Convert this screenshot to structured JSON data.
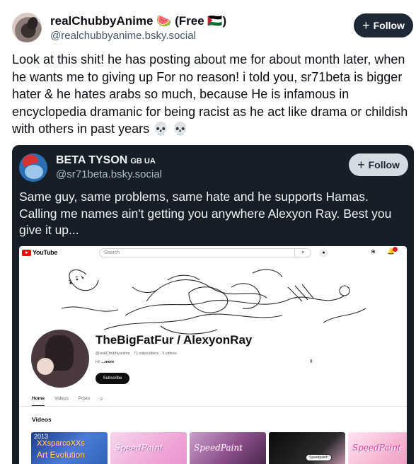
{
  "post": {
    "author_name": "realChubbyAnime 🍉 (Free 🇵🇸)",
    "author_handle": "@realchubbyanime.bsky.social",
    "follow_label": "Follow",
    "text": "Look at this shit! he has posting about me for about month later, when he wants me to giving up For no reason! i told you, sr71beta is bigger hater & he hates arabs so much, because He is infamous in encyclopedia dramanic for being racist as he act like drama or childish with others in past years 💀 💀"
  },
  "embed": {
    "author_name": "BETA TYSON",
    "author_flags": "GB UA",
    "author_handle": "@sr71beta.bsky.social",
    "follow_label": "Follow",
    "text": "Same guy, same problems, same hate and he supports Hamas. Calling me names ain't getting you anywhere Alexyon Ray. Best you give it up...",
    "background": "#161e27"
  },
  "youtube": {
    "logo_text": "YouTube",
    "search_placeholder": "Search",
    "notification_badge": "9+",
    "channel_name": "TheBigFatFur / AlexyonRay",
    "channel_meta": "@realChubbyanime · 71 subscribers · 5 videos",
    "channel_desc_prefix": "Hi!",
    "channel_desc_more": "...more",
    "subscribe_label": "Subscribe",
    "tabs": [
      "Home",
      "Videos",
      "Posts"
    ],
    "active_tab": "Home",
    "section_title": "Videos",
    "thumbnails": [
      {
        "line1": "2013",
        "line2": "XXsparcoXXs",
        "line3": "Art Evolution"
      },
      {
        "script": "SpeedPaint"
      },
      {
        "script": "SpeedPaint"
      },
      {
        "pill": "Speedpaint!"
      },
      {
        "script": "SpeedPaint"
      }
    ]
  },
  "colors": {
    "follow_button_bg": "#1e2936",
    "handle_text": "#42576c",
    "embed_follow_bg": "#d4dbe2",
    "youtube_red": "#ff0000"
  }
}
